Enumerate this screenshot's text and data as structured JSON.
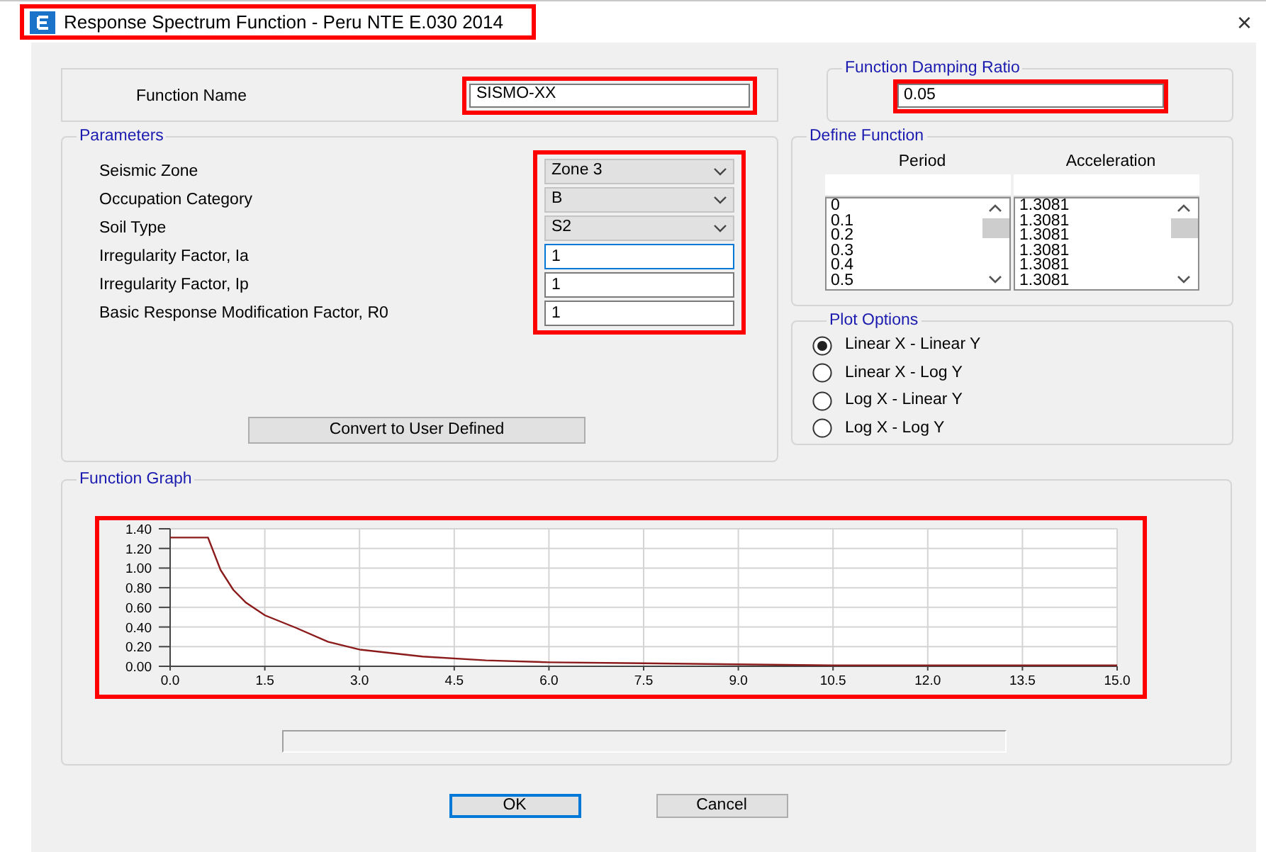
{
  "window": {
    "title": "Response Spectrum Function - Peru NTE E.030 2014",
    "highlighted": true,
    "close": "×"
  },
  "function_name": {
    "label": "Function Name",
    "value": "SISMO-XX",
    "highlighted": true
  },
  "damping": {
    "legend": "Function Damping Ratio",
    "value": "0.05",
    "highlighted": true
  },
  "parameters": {
    "legend": "Parameters",
    "highlighted": true,
    "fields": [
      {
        "kind": "dropdown",
        "label": "Seismic Zone",
        "value": "Zone 3",
        "focused": false
      },
      {
        "kind": "dropdown",
        "label": "Occupation Category",
        "value": "B",
        "focused": false
      },
      {
        "kind": "dropdown",
        "label": "Soil Type",
        "value": "S2",
        "focused": false
      },
      {
        "kind": "text",
        "label": "Irregularity Factor, Ia",
        "value": "1",
        "focused": true
      },
      {
        "kind": "text",
        "label": "Irregularity Factor, Ip",
        "value": "1",
        "focused": false
      },
      {
        "kind": "text",
        "label": "Basic Response Modification Factor, R0",
        "value": "1",
        "focused": false
      }
    ],
    "convert_button": "Convert to User Defined"
  },
  "define_function": {
    "legend": "Define Function",
    "columns": [
      "Period",
      "Acceleration"
    ],
    "rows": [
      [
        "0",
        "1.3081"
      ],
      [
        "0.1",
        "1.3081"
      ],
      [
        "0.2",
        "1.3081"
      ],
      [
        "0.3",
        "1.3081"
      ],
      [
        "0.4",
        "1.3081"
      ],
      [
        "0.5",
        "1.3081"
      ]
    ]
  },
  "plot_options": {
    "legend": "Plot Options",
    "options": [
      {
        "label": "Linear X - Linear Y",
        "selected": true
      },
      {
        "label": "Linear X - Log Y",
        "selected": false
      },
      {
        "label": "Log X - Linear Y",
        "selected": false
      },
      {
        "label": "Log X - Log Y",
        "selected": false
      }
    ]
  },
  "function_graph": {
    "legend": "Function Graph",
    "highlighted": true,
    "chart_data": {
      "type": "line",
      "x": [
        0,
        0.5,
        0.6,
        0.8,
        1,
        1.2,
        1.5,
        2,
        2.5,
        3,
        4,
        5,
        6,
        7.5,
        9,
        10.5,
        12,
        13.5,
        15
      ],
      "series": [
        {
          "color": "#8b1a1a",
          "values": [
            1.31,
            1.31,
            1.31,
            0.98,
            0.78,
            0.65,
            0.52,
            0.39,
            0.25,
            0.17,
            0.1,
            0.06,
            0.04,
            0.03,
            0.02,
            0.01,
            0.01,
            0.01,
            0.01
          ]
        }
      ],
      "grid": true,
      "xlim": [
        0,
        15
      ],
      "ylim": [
        0,
        1.4
      ],
      "xticks": [
        {
          "value": 0,
          "label": "0.0"
        },
        {
          "value": 1.5,
          "label": "1.5"
        },
        {
          "value": 3,
          "label": "3.0"
        },
        {
          "value": 4.5,
          "label": "4.5"
        },
        {
          "value": 6,
          "label": "6.0"
        },
        {
          "value": 7.5,
          "label": "7.5"
        },
        {
          "value": 9,
          "label": "9.0"
        },
        {
          "value": 10.5,
          "label": "10.5"
        },
        {
          "value": 12,
          "label": "12.0"
        },
        {
          "value": 13.5,
          "label": "13.5"
        },
        {
          "value": 15,
          "label": "15.0"
        }
      ],
      "yticks": [
        {
          "value": 0,
          "label": "0.00"
        },
        {
          "value": 0.2,
          "label": "0.20"
        },
        {
          "value": 0.4,
          "label": "0.40"
        },
        {
          "value": 0.6,
          "label": "0.60"
        },
        {
          "value": 0.8,
          "label": "0.80"
        },
        {
          "value": 1,
          "label": "1.00"
        },
        {
          "value": 1.2,
          "label": "1.20"
        },
        {
          "value": 1.4,
          "label": "1.40"
        }
      ]
    }
  },
  "buttons": [
    {
      "label": "OK",
      "default": true
    },
    {
      "label": "Cancel",
      "default": false
    }
  ]
}
